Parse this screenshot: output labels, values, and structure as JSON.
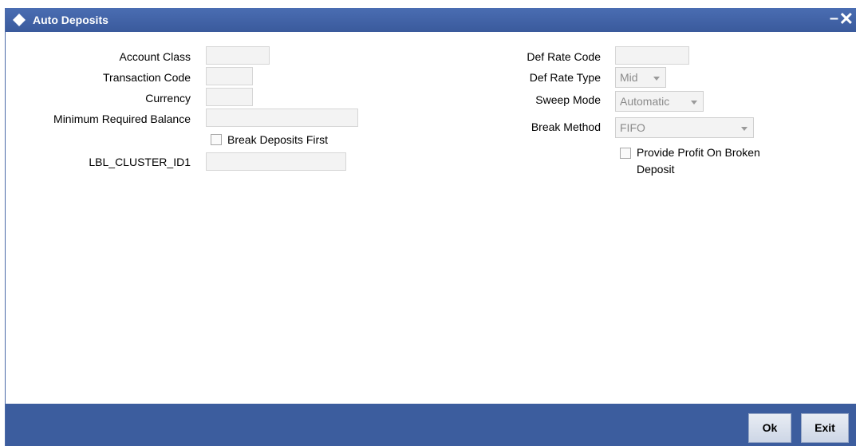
{
  "window": {
    "title": "Auto Deposits",
    "minimize": "–",
    "close": "✕"
  },
  "left": {
    "account_class_label": "Account Class",
    "transaction_code_label": "Transaction Code",
    "currency_label": "Currency",
    "min_balance_label": "Minimum Required Balance",
    "break_deposits_first_label": "Break Deposits First",
    "cluster_id_label": "LBL_CLUSTER_ID1"
  },
  "right": {
    "def_rate_code_label": "Def Rate Code",
    "def_rate_type_label": "Def Rate Type",
    "def_rate_type_value": "Mid",
    "sweep_mode_label": "Sweep Mode",
    "sweep_mode_value": "Automatic",
    "break_method_label": "Break Method",
    "break_method_value": "FIFO",
    "provide_profit_line1": "Provide Profit On Broken",
    "provide_profit_line2": "Deposit"
  },
  "footer": {
    "ok_label": "Ok",
    "exit_label": "Exit"
  },
  "colors": {
    "titlebar": "#3a5a9c",
    "footer": "#3c5d9e"
  }
}
